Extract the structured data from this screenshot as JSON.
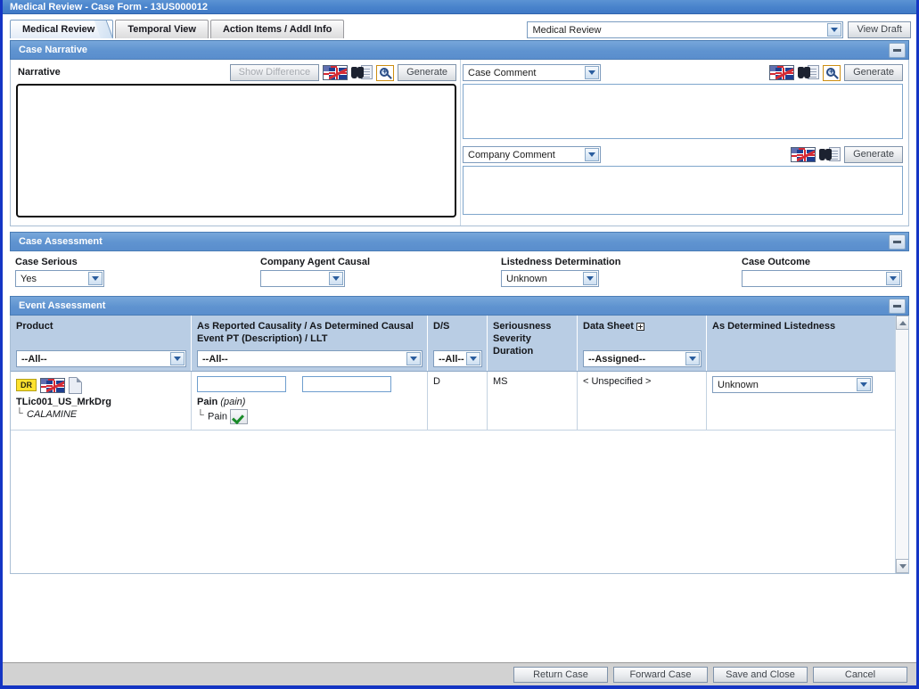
{
  "window": {
    "title": "Medical Review - Case Form - 13US000012"
  },
  "tabs": [
    {
      "label": "Medical Review",
      "active": true
    },
    {
      "label": "Temporal View",
      "active": false
    },
    {
      "label": "Action Items / Addl Info",
      "active": false
    }
  ],
  "topbar": {
    "form_select_value": "Medical Review",
    "view_draft_label": "View Draft"
  },
  "case_narrative": {
    "title": "Case Narrative",
    "narrative_label": "Narrative",
    "narrative_value": "",
    "show_difference_label": "Show Difference",
    "generate_label": "Generate",
    "case_comment_value": "Case Comment",
    "case_comment_text": "",
    "company_comment_value": "Company Comment",
    "company_comment_text": ""
  },
  "case_assessment": {
    "title": "Case Assessment",
    "fields": [
      {
        "label": "Case Serious",
        "value": "Yes"
      },
      {
        "label": "Company Agent Causal",
        "value": ""
      },
      {
        "label": "Listedness Determination",
        "value": "Unknown"
      },
      {
        "label": "Case Outcome",
        "value": ""
      }
    ]
  },
  "event_assessment": {
    "title": "Event Assessment",
    "columns": [
      {
        "header": "Product",
        "filter": "--All--"
      },
      {
        "header": "As Reported Causality / As Determined Causal Event PT (Description) / LLT",
        "filter": "--All--"
      },
      {
        "header": "D/S",
        "filter": "--All--"
      },
      {
        "header": "Seriousness Severity Duration",
        "filter": null
      },
      {
        "header": "Data Sheet",
        "filter": "--Assigned--"
      },
      {
        "header": "As Determined Listedness",
        "filter": null
      }
    ],
    "rows": [
      {
        "product_badge": "DR",
        "product_name": "TLic001_US_MrkDrg",
        "product_sub": "CALAMINE",
        "reported_causality": "",
        "determined_causality": "",
        "event_pt": "Pain",
        "event_pt_desc": "(pain)",
        "event_llt": "Pain",
        "ds": "D",
        "seriousness": "MS",
        "data_sheet": "< Unspecified >",
        "determined_listedness": "Unknown"
      }
    ]
  },
  "footer": {
    "buttons": [
      {
        "label": "Return Case"
      },
      {
        "label": "Forward Case"
      },
      {
        "label": "Save and Close"
      },
      {
        "label": "Cancel"
      }
    ]
  }
}
